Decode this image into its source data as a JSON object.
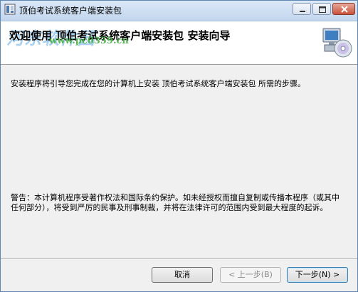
{
  "window": {
    "title": "顶伯考试系统客户端安装包"
  },
  "header": {
    "title": "欢迎使用 顶伯考试系统客户端安装包 安装向导",
    "watermark_main": "河东软件园",
    "watermark_url": "www.pc0359.cn"
  },
  "body": {
    "intro": "安装程序将引导您完成在您的计算机上安装 顶伯考试系统客户端安装包 所需的步骤。",
    "warning": "警告：本计算机程序受著作权法和国际条约保护。如未经授权而擅自复制或传播本程序（或其中任何部分），将受到严厉的民事及刑事制裁，并将在法律许可的范围内受到最大程度的起诉。"
  },
  "buttons": {
    "cancel": "取消",
    "prev": "< 上一步(B)",
    "next": "下一步(N) >"
  },
  "icons": {
    "title": "installer-icon",
    "header": "computer-cd-icon"
  },
  "colors": {
    "titlebar": "#c3d6ee",
    "close_button": "#c8513a",
    "watermark": "#5faae1",
    "watermark_url": "#3caa3c"
  }
}
